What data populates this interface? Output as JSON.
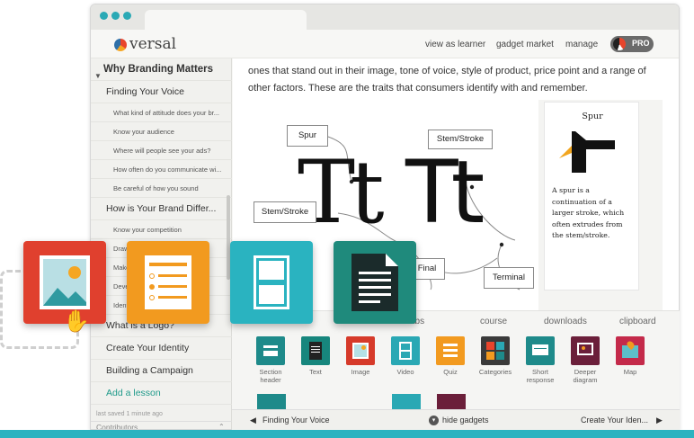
{
  "app": {
    "logo_text": "versal",
    "nav": {
      "view_as_learner": "view as learner",
      "gadget_market": "gadget market",
      "manage": "manage",
      "pro": "PRO"
    }
  },
  "sidebar": {
    "section_title": "Why Branding Matters",
    "items": [
      {
        "label": "Finding Your Voice",
        "level": 2
      },
      {
        "label": "What kind of attitude does your br...",
        "level": 3
      },
      {
        "label": "Know your audience",
        "level": 3
      },
      {
        "label": "Where will people see your ads?",
        "level": 3
      },
      {
        "label": "How often do you communicate wi...",
        "level": 3
      },
      {
        "label": "Be careful of how you sound",
        "level": 3
      },
      {
        "label": "How is Your Brand Differ...",
        "level": 2
      },
      {
        "label": "Know your competition",
        "level": 3
      },
      {
        "label": "Draw",
        "level": 3
      },
      {
        "label": "Make",
        "level": 3
      },
      {
        "label": "Deve",
        "level": 3
      },
      {
        "label": "Ident",
        "level": 3
      },
      {
        "label": "What is a Logo?",
        "level": 1
      },
      {
        "label": "Create Your Identity",
        "level": 1
      },
      {
        "label": "Building a Campaign",
        "level": 1
      },
      {
        "label": "Add a lesson",
        "level": 1
      }
    ],
    "last_saved": "last saved 1 minute ago",
    "contributors": "Contributors"
  },
  "content": {
    "paragraph": "ones that stand out in their image, tone of voice, style of product, price point and a range of other factors. These are the traits that consumers identify with and remember.",
    "diagram": {
      "serif_sample": "Tt",
      "sans_sample": "Tt",
      "labels": {
        "spur": "Spur",
        "stem_stroke_left": "Stem/Stroke",
        "stem_stroke_right": "Stem/Stroke",
        "final": "Final",
        "terminal": "Terminal"
      }
    },
    "detail": {
      "title": "Spur",
      "body": "A spur is a continuation of a larger stroke, which often extrudes from the stem/stroke."
    }
  },
  "tray": {
    "tabs": [
      "abs",
      "course",
      "downloads",
      "clipboard"
    ],
    "gadgets": [
      {
        "label": "Section header",
        "color": "#1e8a8a",
        "icon": "section-header-icon"
      },
      {
        "label": "Text",
        "color": "#17867d",
        "icon": "text-icon"
      },
      {
        "label": "Image",
        "color": "#d63a2a",
        "icon": "image-icon"
      },
      {
        "label": "Video",
        "color": "#2aa8b4",
        "icon": "video-icon"
      },
      {
        "label": "Quiz",
        "color": "#f29a1f",
        "icon": "quiz-icon"
      },
      {
        "label": "Categories",
        "color": "#3a3a3a",
        "icon": "categories-icon"
      },
      {
        "label": "Short response",
        "color": "#1e8a8a",
        "icon": "short-response-icon"
      },
      {
        "label": "Deeper diagram",
        "color": "#6b1f3a",
        "icon": "deeper-diagram-icon"
      },
      {
        "label": "Map",
        "color": "#c42a4a",
        "icon": "map-icon"
      }
    ]
  },
  "bottombar": {
    "prev": "Finding Your Voice",
    "hide": "hide gadgets",
    "next": "Create Your Iden..."
  },
  "floating_cards": [
    {
      "name": "image",
      "color": "#e0402e"
    },
    {
      "name": "quiz",
      "color": "#f29a1f"
    },
    {
      "name": "video",
      "color": "#2ab3c0"
    },
    {
      "name": "text",
      "color": "#1f8a7c"
    }
  ]
}
